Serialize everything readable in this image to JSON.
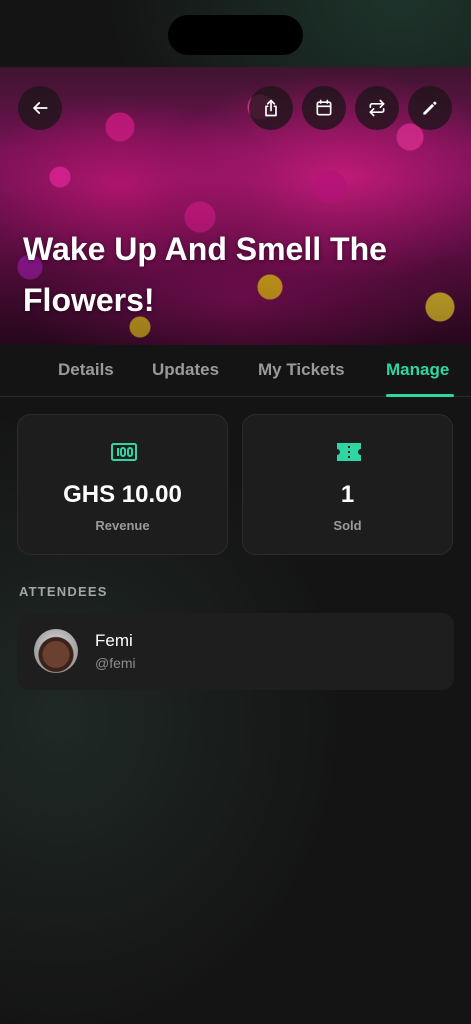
{
  "event": {
    "title": "Wake Up And Smell The Flowers!"
  },
  "header_actions": {
    "back": "arrow-left-icon",
    "share": "share-icon",
    "calendar": "calendar-icon",
    "repost": "repeat-icon",
    "edit": "pencil-icon"
  },
  "tabs": [
    {
      "label": "Details",
      "active": false
    },
    {
      "label": "Updates",
      "active": false
    },
    {
      "label": "My Tickets",
      "active": false
    },
    {
      "label": "Manage",
      "active": true
    }
  ],
  "stats": {
    "revenue": {
      "value": "GHS 10.00",
      "label": "Revenue",
      "icon": "cash-icon"
    },
    "sold": {
      "value": "1",
      "label": "Sold",
      "icon": "ticket-icon"
    }
  },
  "attendees": {
    "section_title": "ATTENDEES",
    "items": [
      {
        "name": "Femi",
        "handle": "@femi"
      }
    ]
  },
  "colors": {
    "accent": "#2fd6a4",
    "background": "#141414",
    "card": "#1d1d1d"
  }
}
